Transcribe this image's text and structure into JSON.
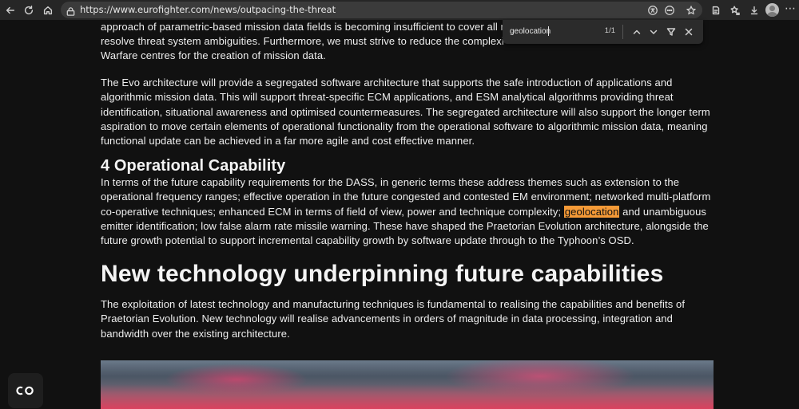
{
  "browser": {
    "url": "https://www.eurofighter.com/news/outpacing-the-threat",
    "icons": [
      "back-icon",
      "refresh-icon",
      "home-icon",
      "site-info-icon",
      "translate-icon",
      "extension-icon",
      "favorite-icon",
      "collections-icon",
      "favorites-bar-icon",
      "downloads-icon",
      "profile-avatar",
      "more-icon"
    ]
  },
  "find": {
    "query": "geolocation",
    "count": "1/1"
  },
  "article": {
    "p1": [
      "approach of parametric-based mission data fields is becoming insufficient to cover all m",
      "resolve threat system ambiguities.  Furthermore, we must strive to reduce the complexi",
      "Warfare centres for the creation of mission data."
    ],
    "p2": [
      "The Evo architecture will provide a segregated software architecture that supports the safe introduction of applications and",
      "algorithmic mission data.  This will support threat-specific ECM applications, and ESM analytical algorithms providing threat",
      "identification, situational awareness and optimised countermeasures. The segregated architecture will also support the longer term",
      "aspiration to move certain elements of operational functionality from the operational software to algorithmic mission data, meaning",
      "functional update can be achieved in a far more agile and cost effective manner."
    ],
    "h3": "4 Operational Capability",
    "p3": {
      "line1": "In terms of the future capability requirements for the DASS, in generic terms these address themes such as extension to the",
      "line2": "operational frequency ranges; effective operation in the future congested and contested EM environment; networked multi-platform",
      "line3_before": "co-operative techniques; enhanced ECM in terms of field of view, power and technique complexity; ",
      "line3_highlight": "geolocation",
      "line3_after": " and unambiguous",
      "line4": "emitter identification; low false alarm rate missile warning.  These have shaped the Praetorian Evolution architecture, alongside the",
      "line5": "future growth potential to support incremental capability growth by software update through to the Typhoon’s OSD."
    },
    "h2": "New technology underpinning future capabilities",
    "p4": [
      "The exploitation of latest technology and manufacturing techniques is fundamental  to realising the capabilities and benefits of",
      "Praetorian Evolution. New technology will realise advancements in orders of magnitude in data processing, integration and",
      "bandwidth over the existing architecture."
    ]
  },
  "colors": {
    "highlight": "#f59a37",
    "page_bg": "#111111",
    "toolbar_bg": "#262626"
  }
}
